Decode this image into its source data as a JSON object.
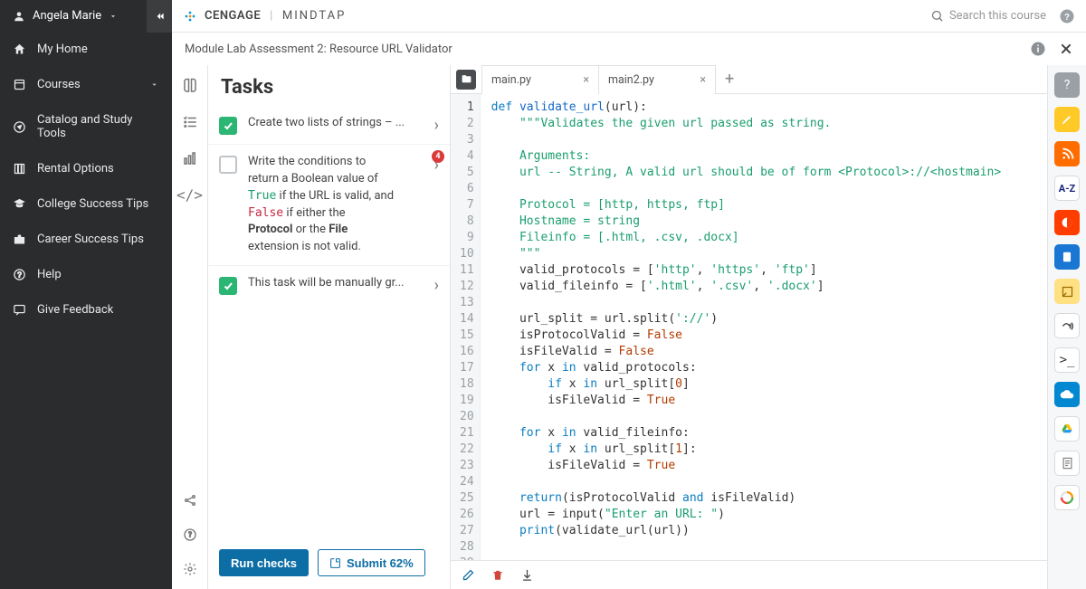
{
  "user": {
    "name": "Angela Marie"
  },
  "sidebar": {
    "items": [
      {
        "label": "My Home"
      },
      {
        "label": "Courses"
      },
      {
        "label": "Catalog and Study Tools"
      },
      {
        "label": "Rental Options"
      },
      {
        "label": "College Success Tips"
      },
      {
        "label": "Career Success Tips"
      },
      {
        "label": "Help"
      },
      {
        "label": "Give Feedback"
      }
    ]
  },
  "brand": {
    "cengage": "CENGAGE",
    "mindtap": "MINDTAP"
  },
  "search_placeholder": "Search this course",
  "module_title": "Module Lab Assessment 2: Resource URL Validator",
  "tasks_title": "Tasks",
  "tasks": [
    {
      "done": true,
      "text_short": "Create two lists of strings – ..."
    },
    {
      "done": false,
      "badge": "4",
      "lines": [
        "Write the conditions to",
        "return a Boolean value of",
        "<span class='kw-true'>True</span>  if the URL is valid, and",
        "<span class='kw-false'>False</span>  if either the",
        "<b>Protocol</b> or the <b>File</b>",
        "extension is not valid."
      ]
    },
    {
      "done": true,
      "text_short": "This task will be manually gr..."
    }
  ],
  "buttons": {
    "run": "Run checks",
    "submit": "Submit 62%"
  },
  "tabs": [
    {
      "name": "main.py"
    },
    {
      "name": "main2.py"
    }
  ],
  "code": [
    "<span class='k'>def</span> <span class='fn'>validate_url</span>(url):",
    "    <span class='s'>\"\"\"Validates the given url passed as string.</span>",
    "",
    "    <span class='s'>Arguments:</span>",
    "    <span class='s'>url -- String, A valid url should be of form &lt;Protocol&gt;://&lt;hostmain&gt;</span>",
    "",
    "    <span class='s'>Protocol = [http, https, ftp]</span>",
    "    <span class='s'>Hostname = string</span>",
    "    <span class='s'>Fileinfo = [.html, .csv, .docx]</span>",
    "    <span class='s'>\"\"\"</span>",
    "    valid_protocols = [<span class='s'>'http'</span>, <span class='s'>'https'</span>, <span class='s'>'ftp'</span>]",
    "    valid_fileinfo = [<span class='s'>'.html'</span>, <span class='s'>'.csv'</span>, <span class='s'>'.docx'</span>]",
    "",
    "    url_split = url.split(<span class='s'>'://'</span>)",
    "    isProtocolValid = <span class='n'>False</span>",
    "    isFileValid = <span class='n'>False</span>",
    "    <span class='k'>for</span> x <span class='k'>in</span> valid_protocols:",
    "        <span class='k'>if</span> x <span class='k'>in</span> url_split[<span class='n'>0</span>]",
    "        isFileValid = <span class='n'>True</span>",
    "",
    "    <span class='k'>for</span> x <span class='k'>in</span> valid_fileinfo:",
    "        <span class='k'>if</span> x <span class='k'>in</span> url_split[<span class='n'>1</span>]:",
    "        isFileValid = <span class='n'>True</span>",
    "",
    "    <span class='k'>return</span>(isProtocolValid <span class='k'>and</span> isFileValid)",
    "    url = input(<span class='s'>\"Enter an URL: \"</span>)",
    "    <span class='k'>print</span>(validate_url(url))",
    "",
    ""
  ]
}
